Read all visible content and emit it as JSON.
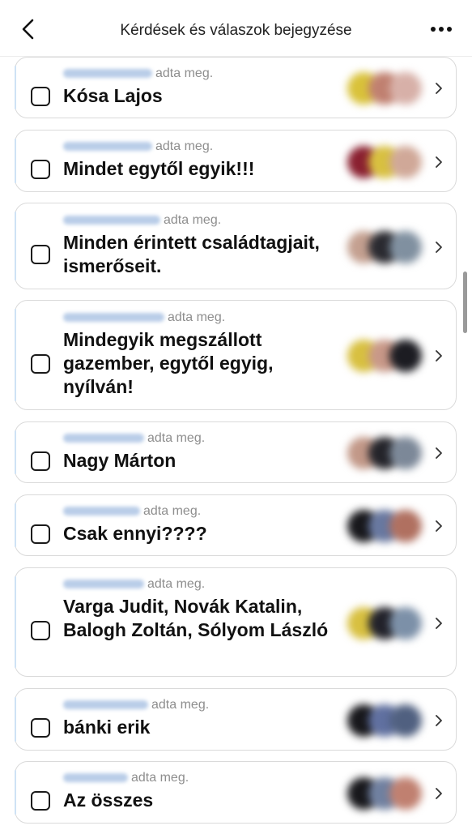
{
  "header": {
    "title": "Kérdések és válaszok bejegyzése"
  },
  "icons": {
    "back": "chevron-left-icon",
    "more": "more-horizontal-icon",
    "row": "chevron-right-icon"
  },
  "author_suffix": "adta meg.",
  "answers": [
    {
      "text": "Kósa Lajos",
      "avatars": [
        "#d9c23a",
        "#c08070",
        "#d7b0a8"
      ]
    },
    {
      "text": "Mindet egytől egyik!!!",
      "avatars": [
        "#8a2030",
        "#d8c040",
        "#d0a898"
      ]
    },
    {
      "text": "Minden érintett családtagjait, ismerőseit.",
      "avatars": [
        "#c4a090",
        "#2a2a30",
        "#8090a0"
      ]
    },
    {
      "text": "Mindegyik megszállott gazember, egytől egyig, nyílván!",
      "avatars": [
        "#d8c040",
        "#c89888",
        "#1c1c22"
      ]
    },
    {
      "text": "Nagy Márton",
      "avatars": [
        "#c29888",
        "#24242a",
        "#7c8898"
      ]
    },
    {
      "text": "Csak ennyi????",
      "avatars": [
        "#18181c",
        "#6878a0",
        "#b07060"
      ]
    },
    {
      "text": "Varga Judit, Novák Katalin, Balogh Zoltán, Sólyom László",
      "avatars": [
        "#d8c040",
        "#22222a",
        "#7c90a8"
      ]
    },
    {
      "text": "bánki erik",
      "avatars": [
        "#18181c",
        "#6070a0",
        "#506080"
      ]
    },
    {
      "text": "Az összes",
      "avatars": [
        "#18181c",
        "#7080a0",
        "#c08070"
      ]
    }
  ]
}
